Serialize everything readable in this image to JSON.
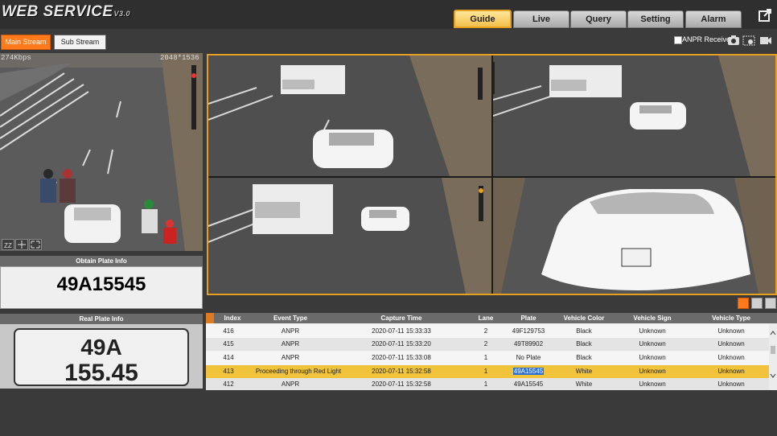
{
  "app": {
    "logo_text": "WEB  SERVICE",
    "logo_version": "V3.0"
  },
  "nav": {
    "tabs": [
      {
        "label": "Guide",
        "active": true
      },
      {
        "label": "Live",
        "active": false
      },
      {
        "label": "Query",
        "active": false
      },
      {
        "label": "Setting",
        "active": false
      },
      {
        "label": "Alarm",
        "active": false
      }
    ]
  },
  "stream": {
    "main_label": "Main Stream",
    "sub_label": "Sub Stream",
    "selected": "Main Stream"
  },
  "anpr": {
    "receive_label": "ANPR Receive",
    "checked": false
  },
  "left_video": {
    "bitrate": "274Kbps",
    "resolution": "2048*1536"
  },
  "plate": {
    "obtain_title": "Obtain Plate Info",
    "obtain_value": "49A15545",
    "real_title": "Real Plate Info",
    "real_line1": "49A",
    "real_line2": "155.45"
  },
  "table": {
    "headers": [
      "Index",
      "Event Type",
      "Capture Time",
      "Lane",
      "Plate",
      "Vehicle Color",
      "Vehicle Sign",
      "Vehicle Type"
    ],
    "rows": [
      {
        "index": "416",
        "event": "ANPR",
        "time": "2020-07-11 15:33:33",
        "lane": "2",
        "plate": "49F129753",
        "color": "Black",
        "sign": "Unknown",
        "type": "Unknown",
        "selected": false
      },
      {
        "index": "415",
        "event": "ANPR",
        "time": "2020-07-11 15:33:20",
        "lane": "2",
        "plate": "49T89902",
        "color": "Black",
        "sign": "Unknown",
        "type": "Unknown",
        "selected": false
      },
      {
        "index": "414",
        "event": "ANPR",
        "time": "2020-07-11 15:33:08",
        "lane": "1",
        "plate": "No Plate",
        "color": "Black",
        "sign": "Unknown",
        "type": "Unknown",
        "selected": false
      },
      {
        "index": "413",
        "event": "Proceeding through Red Light",
        "time": "2020-07-11 15:32:58",
        "lane": "1",
        "plate": "49A15545",
        "color": "White",
        "sign": "Unknown",
        "type": "Unknown",
        "selected": true
      },
      {
        "index": "412",
        "event": "ANPR",
        "time": "2020-07-11 15:32:58",
        "lane": "1",
        "plate": "49A15545",
        "color": "White",
        "sign": "Unknown",
        "type": "Unknown",
        "selected": false
      }
    ]
  },
  "colors": {
    "accent": "#ff7a1a",
    "active_tab": "#f2c04c",
    "selected_row": "#f0c33a",
    "header_bg": "#2f2f2f"
  },
  "icons": [
    "export-icon",
    "snapshot-icon",
    "settings-icon",
    "record-icon",
    "zoom-icon",
    "ptz-icon",
    "fullscreen-icon",
    "single-view-icon",
    "quad-view-icon"
  ]
}
